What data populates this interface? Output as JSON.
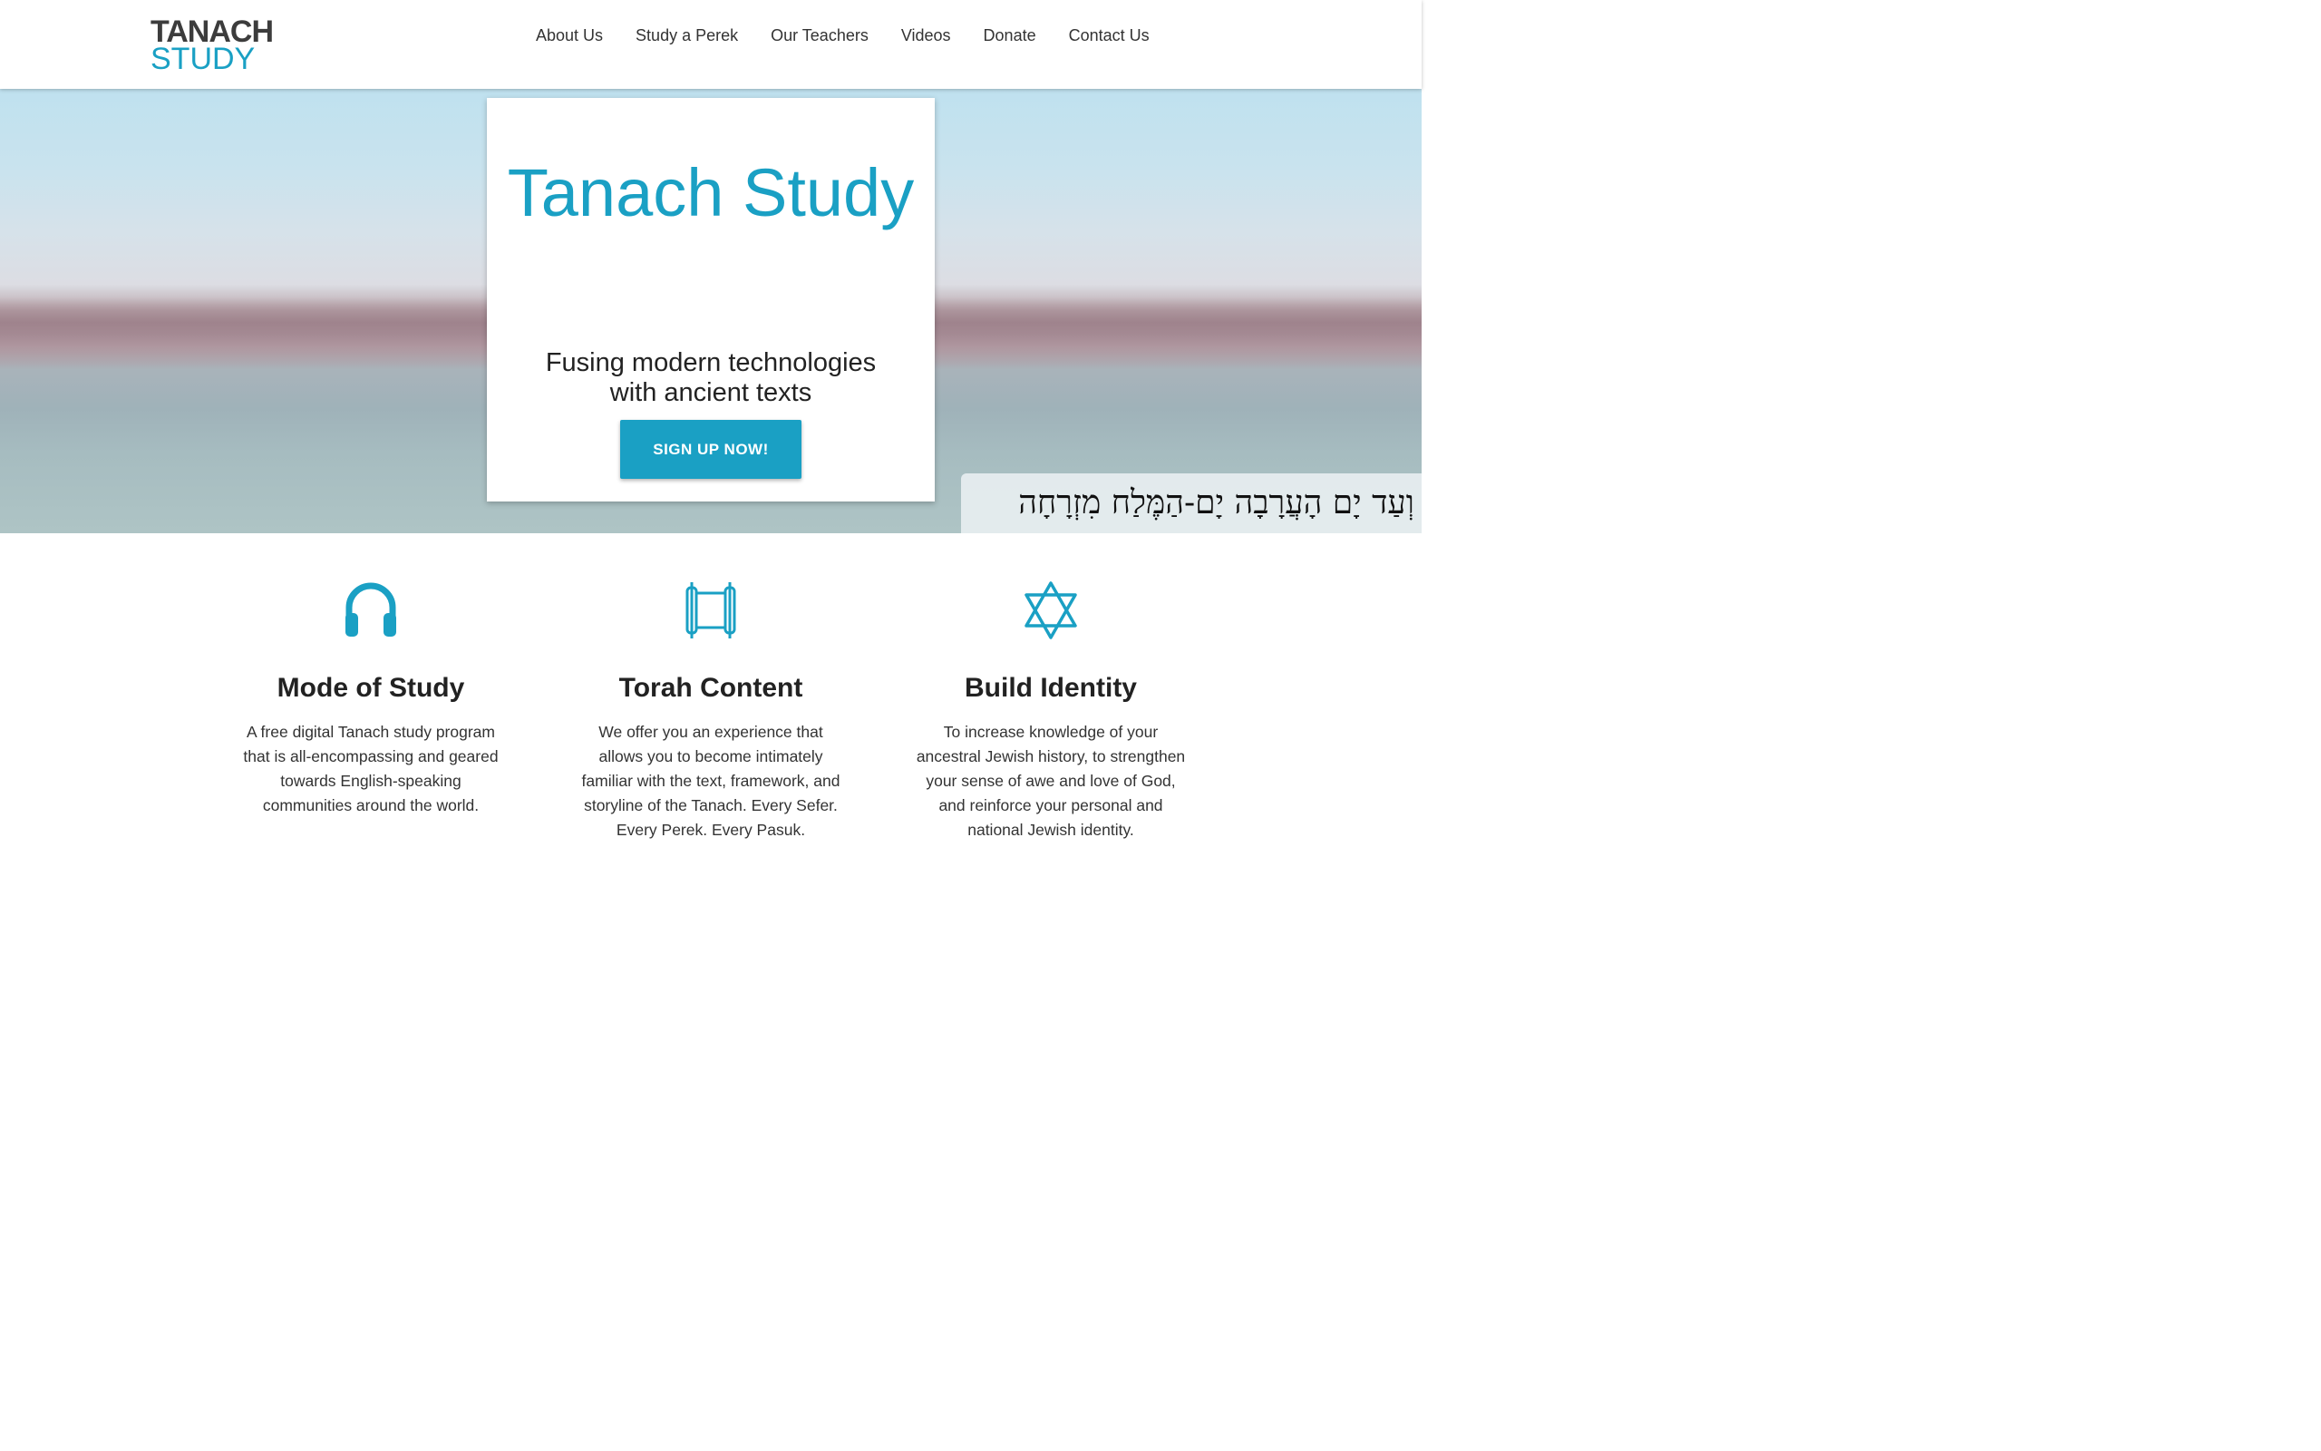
{
  "header": {
    "logo_top": "TANACH",
    "logo_bottom": "STUDY",
    "nav": [
      {
        "label": "About Us"
      },
      {
        "label": "Study a Perek"
      },
      {
        "label": "Our Teachers"
      },
      {
        "label": "Videos"
      },
      {
        "label": "Donate"
      },
      {
        "label": "Contact Us"
      }
    ]
  },
  "hero": {
    "title": "Tanach Study",
    "subtitle": "Fusing modern technologies with ancient texts",
    "cta_label": "SIGN UP NOW!",
    "verse": "וְעַד יָם הָעֲרָבָה יָם-הַמֶּלַח מִזְרָחָה"
  },
  "features": [
    {
      "icon": "headphones-icon",
      "title": "Mode of Study",
      "text": "A free digital Tanach study program that is all-encompassing and geared towards English-speaking communities around the world."
    },
    {
      "icon": "torah-scroll-icon",
      "title": "Torah Content",
      "text": "We offer you an experience that allows you to become intimately familiar with the text, framework, and storyline of the Tanach. Every Sefer. Every Perek. Every Pasuk."
    },
    {
      "icon": "star-of-david-icon",
      "title": "Build Identity",
      "text": "To increase knowledge of your ancestral Jewish history, to strengthen your sense of awe and love of God, and reinforce your personal and national Jewish identity."
    }
  ],
  "colors": {
    "accent": "#1aa0c4",
    "logo_dark": "#3c3c3c",
    "text": "#222222"
  }
}
